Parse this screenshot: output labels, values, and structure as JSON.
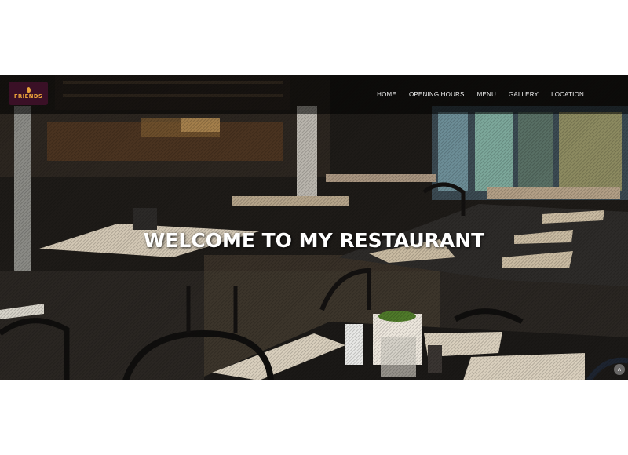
{
  "brand": {
    "name": "FRIENDS",
    "accent": "#e9a13a",
    "logo_bg": "#3a1026"
  },
  "nav": {
    "items": [
      {
        "label": "HOME"
      },
      {
        "label": "OPENING HOURS"
      },
      {
        "label": "MENU"
      },
      {
        "label": "GALLERY"
      },
      {
        "label": "LOCATION"
      }
    ]
  },
  "hero": {
    "title": "WELCOME TO MY RESTAURANT"
  },
  "corner_button": {
    "icon": "chevron-up-icon",
    "glyph": "˄"
  }
}
